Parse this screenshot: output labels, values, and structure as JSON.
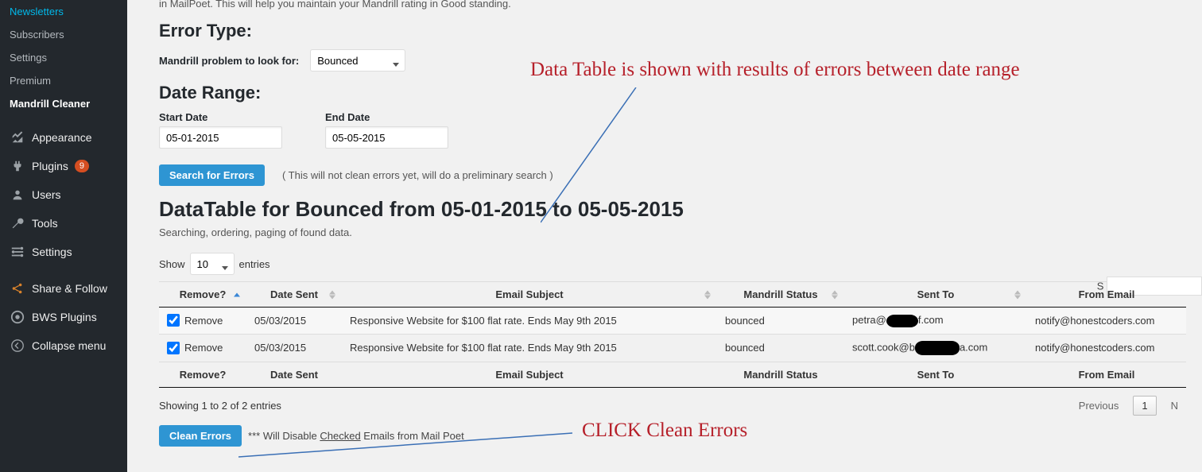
{
  "sidebar": {
    "sub_items": [
      {
        "label": "Newsletters"
      },
      {
        "label": "Subscribers"
      },
      {
        "label": "Settings"
      },
      {
        "label": "Premium"
      },
      {
        "label": "Mandrill Cleaner",
        "active": true
      }
    ],
    "main_items": [
      {
        "icon": "appearance",
        "label": "Appearance"
      },
      {
        "icon": "plugins",
        "label": "Plugins",
        "badge": "9"
      },
      {
        "icon": "users",
        "label": "Users"
      },
      {
        "icon": "tools",
        "label": "Tools"
      },
      {
        "icon": "settings",
        "label": "Settings"
      }
    ],
    "extra_items": [
      {
        "icon": "share",
        "label": "Share & Follow"
      },
      {
        "icon": "bws",
        "label": "BWS Plugins"
      }
    ],
    "collapse": "Collapse menu"
  },
  "intro_cut": "in MailPoet. This will help you maintain your Mandrill rating in Good standing.",
  "error_type_heading": "Error Type:",
  "mandrill_label": "Mandrill problem to look for:",
  "mandrill_value": "Bounced",
  "date_range_heading": "Date Range:",
  "start_date_label": "Start Date",
  "start_date_value": "05-01-2015",
  "end_date_label": "End Date",
  "end_date_value": "05-05-2015",
  "search_button": "Search for Errors",
  "search_note": "( This will not clean errors yet, will do a preliminary search )",
  "datatable_title": "DataTable for Bounced from 05-01-2015 to 05-05-2015",
  "datatable_sub": "Searching, ordering, paging of found data.",
  "show_label": "Show",
  "entries_label": "entries",
  "length_value": "10",
  "search_filter_label": "S",
  "columns": {
    "remove": "Remove?",
    "date_sent": "Date Sent",
    "subject": "Email Subject",
    "status": "Mandrill Status",
    "sent_to": "Sent To",
    "from": "From Email"
  },
  "rows": [
    {
      "remove_label": "Remove",
      "checked": true,
      "date": "05/03/2015",
      "subject": "Responsive Website for $100 flat rate. Ends May 9th 2015",
      "status": "bounced",
      "sent_to_pre": "petra@",
      "sent_to_post": "f.com",
      "from": "notify@honestcoders.com"
    },
    {
      "remove_label": "Remove",
      "checked": true,
      "date": "05/03/2015",
      "subject": "Responsive Website for $100 flat rate. Ends May 9th 2015",
      "status": "bounced",
      "sent_to_pre": "scott.cook@b",
      "sent_to_post": "a.com",
      "from": "notify@honestcoders.com"
    }
  ],
  "info_text": "Showing 1 to 2 of 2 entries",
  "paginate": {
    "prev": "Previous",
    "page1": "1",
    "next": "N"
  },
  "clean_button": "Clean Errors",
  "clean_note_pre": "*** Will Disable ",
  "clean_note_u": "Checked",
  "clean_note_post": " Emails from Mail Poet",
  "annotation_a": "Data Table is shown with results of errors between date range",
  "annotation_b": "CLICK Clean Errors"
}
